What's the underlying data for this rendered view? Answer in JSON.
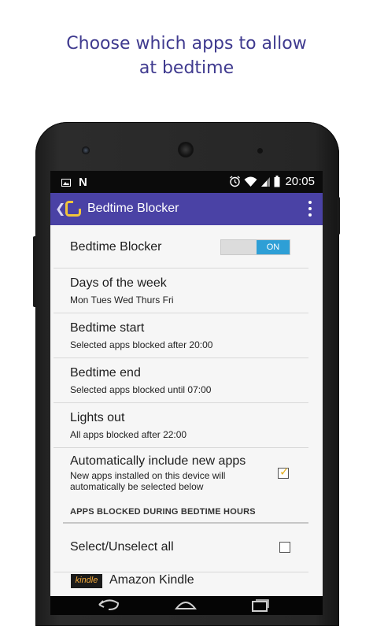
{
  "headline": {
    "line1": "Choose which apps to allow",
    "line2": "at bedtime"
  },
  "status_bar": {
    "time": "20:05",
    "notification_letter": "N"
  },
  "app_bar": {
    "title": "Bedtime Blocker",
    "back_glyph": "❮"
  },
  "settings": {
    "bedtime_blocker": {
      "title": "Bedtime Blocker",
      "toggle_label": "ON",
      "enabled": true
    },
    "days": {
      "title": "Days of the week",
      "value": "Mon Tues Wed Thurs Fri"
    },
    "bedtime_start": {
      "title": "Bedtime start",
      "value": "Selected apps blocked after 20:00"
    },
    "bedtime_end": {
      "title": "Bedtime end",
      "value": "Selected apps blocked until 07:00"
    },
    "lights_out": {
      "title": "Lights out",
      "value": "All apps blocked after 22:00"
    },
    "auto_include": {
      "title": "Automatically include new apps",
      "line1": "New apps installed on this device will",
      "line2": "automatically be selected below",
      "checked": true
    }
  },
  "section_header": "APPS BLOCKED DURING BEDTIME HOURS",
  "select_all": {
    "label": "Select/Unselect all",
    "checked": false
  },
  "apps": [
    {
      "name": "Amazon Kindle",
      "logo_text": "kindle"
    }
  ],
  "colors": {
    "accent": "#4a42a5",
    "headline": "#3f3a8f",
    "toggle_on": "#2e9fd6",
    "check": "#e5b021"
  }
}
